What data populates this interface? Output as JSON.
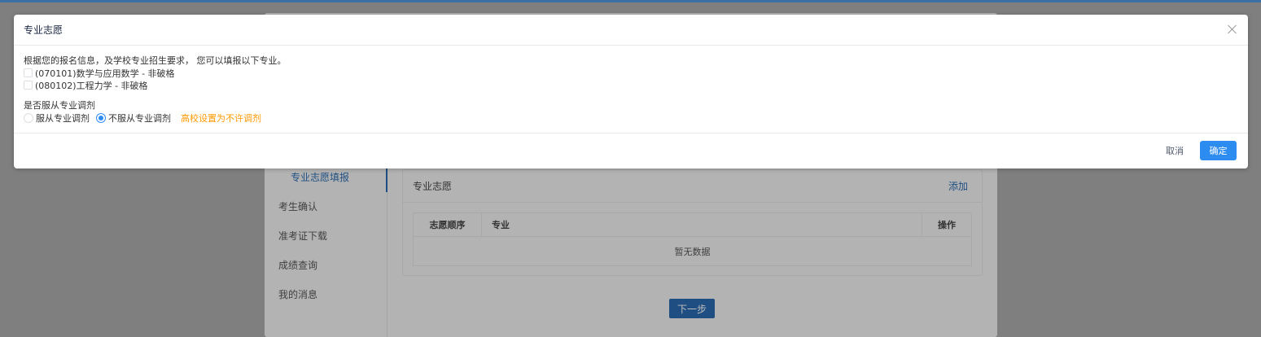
{
  "colors": {
    "primary": "#2d8cf0",
    "warning": "#ff9900",
    "overlay": "#7f7f7f"
  },
  "background": {
    "nav_items": [
      {
        "label": "专业志愿填报",
        "active": true
      },
      {
        "label": "考生确认",
        "active": false
      },
      {
        "label": "准考证下载",
        "active": false
      },
      {
        "label": "成绩查询",
        "active": false
      },
      {
        "label": "我的消息",
        "active": false
      }
    ],
    "major_panel": {
      "title": "专业志愿",
      "add_label": "添加",
      "columns": [
        "志愿顺序",
        "专业",
        "操作"
      ],
      "empty_text": "暂无数据"
    },
    "next_label": "下一步"
  },
  "modal": {
    "title": "专业志愿",
    "intro": "根据您的报名信息，及学校专业招生要求， 您可以填报以下专业。",
    "majors": [
      {
        "label": "(070101)数学与应用数学 - 非破格",
        "checked": false
      },
      {
        "label": "(080102)工程力学 - 非破格",
        "checked": false
      }
    ],
    "adjust_label": "是否服从专业调剂",
    "adjust_options": [
      {
        "label": "服从专业调剂",
        "checked": false
      },
      {
        "label": "不服从专业调剂",
        "checked": true
      }
    ],
    "adjust_notice": "高校设置为不许调剂",
    "cancel_label": "取消",
    "ok_label": "确定"
  }
}
